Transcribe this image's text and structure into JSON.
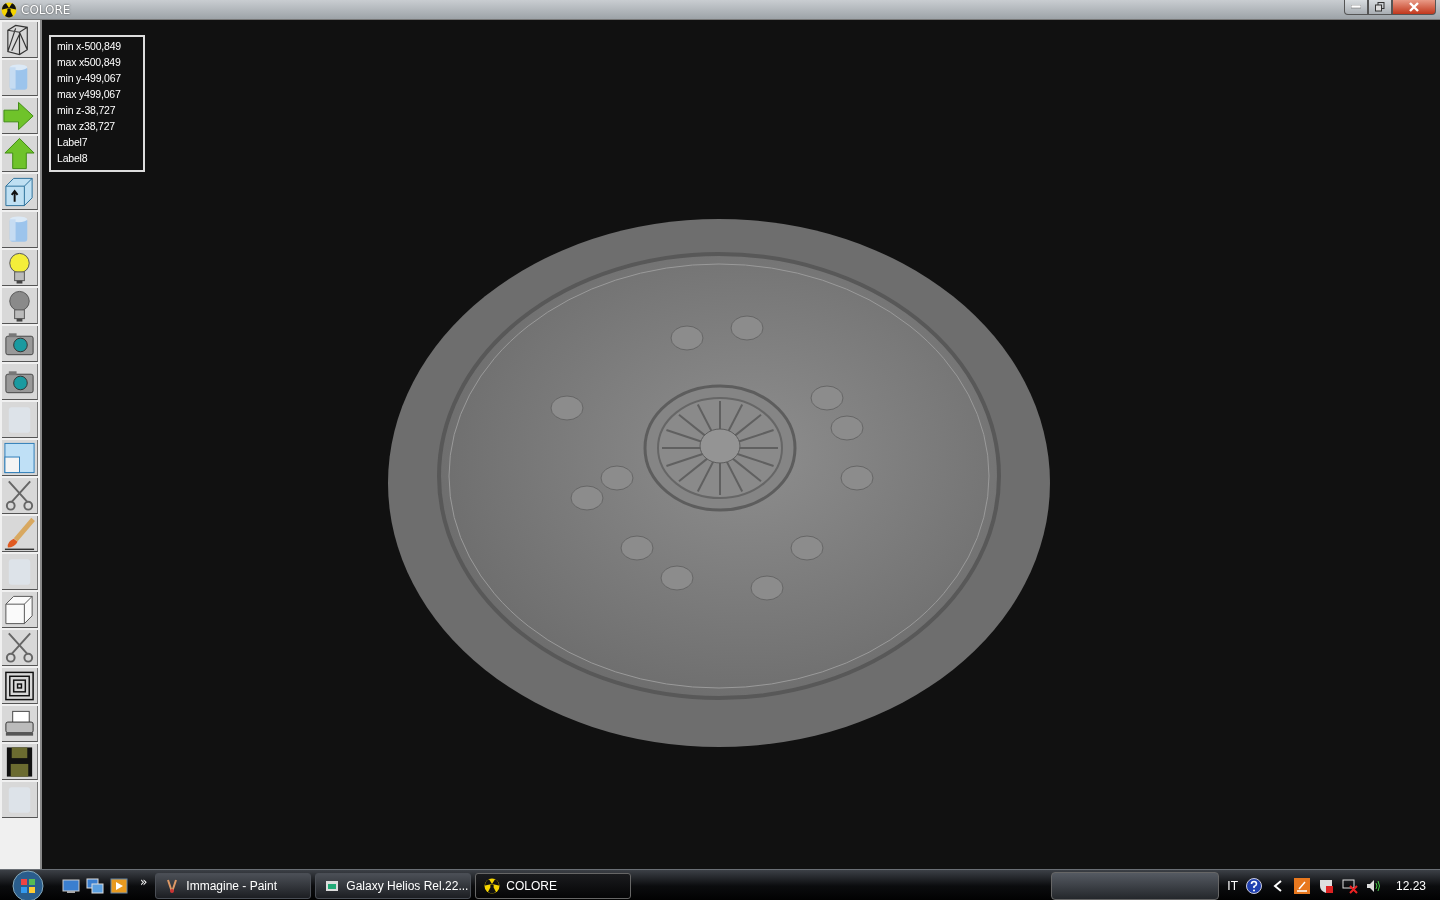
{
  "window": {
    "title": "COLORE"
  },
  "toolbar": {
    "buttons": [
      {
        "kind": "wireframe"
      },
      {
        "kind": "cylinder"
      },
      {
        "kind": "arrow-right"
      },
      {
        "kind": "arrow-up"
      },
      {
        "kind": "box-arrow"
      },
      {
        "kind": "cylinder"
      },
      {
        "kind": "bulb-on"
      },
      {
        "kind": "bulb-off"
      },
      {
        "kind": "camera"
      },
      {
        "kind": "camera"
      },
      {
        "kind": "texture"
      },
      {
        "kind": "window"
      },
      {
        "kind": "scissors"
      },
      {
        "kind": "brush"
      },
      {
        "kind": "texture"
      },
      {
        "kind": "cube"
      },
      {
        "kind": "scissors"
      },
      {
        "kind": "squares"
      },
      {
        "kind": "printer"
      },
      {
        "kind": "floppy"
      },
      {
        "kind": "texture"
      }
    ]
  },
  "info_panel": {
    "lines": [
      "min x-500,849",
      "max x500,849",
      "min y-499,067",
      "max y499,067",
      "min z-38,727",
      "max z38,727",
      "Label7",
      "Label8"
    ]
  },
  "taskbar": {
    "quick_launch_more": "»",
    "tasks": [
      {
        "label": "Immagine - Paint",
        "kind": "paint",
        "selected": false
      },
      {
        "label": "Galaxy Helios  Rel.22...",
        "kind": "helios",
        "selected": false
      },
      {
        "label": "COLORE",
        "kind": "colore",
        "selected": true
      }
    ],
    "language": "IT",
    "clock": "12.23"
  }
}
